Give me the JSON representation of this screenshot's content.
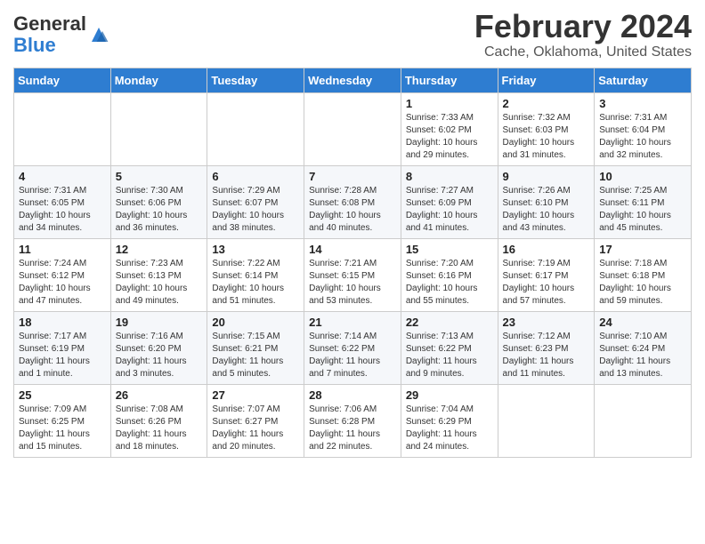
{
  "logo": {
    "general": "General",
    "blue": "Blue"
  },
  "title": "February 2024",
  "subtitle": "Cache, Oklahoma, United States",
  "days_header": [
    "Sunday",
    "Monday",
    "Tuesday",
    "Wednesday",
    "Thursday",
    "Friday",
    "Saturday"
  ],
  "weeks": [
    [
      {
        "day": "",
        "info": ""
      },
      {
        "day": "",
        "info": ""
      },
      {
        "day": "",
        "info": ""
      },
      {
        "day": "",
        "info": ""
      },
      {
        "day": "1",
        "info": "Sunrise: 7:33 AM\nSunset: 6:02 PM\nDaylight: 10 hours\nand 29 minutes."
      },
      {
        "day": "2",
        "info": "Sunrise: 7:32 AM\nSunset: 6:03 PM\nDaylight: 10 hours\nand 31 minutes."
      },
      {
        "day": "3",
        "info": "Sunrise: 7:31 AM\nSunset: 6:04 PM\nDaylight: 10 hours\nand 32 minutes."
      }
    ],
    [
      {
        "day": "4",
        "info": "Sunrise: 7:31 AM\nSunset: 6:05 PM\nDaylight: 10 hours\nand 34 minutes."
      },
      {
        "day": "5",
        "info": "Sunrise: 7:30 AM\nSunset: 6:06 PM\nDaylight: 10 hours\nand 36 minutes."
      },
      {
        "day": "6",
        "info": "Sunrise: 7:29 AM\nSunset: 6:07 PM\nDaylight: 10 hours\nand 38 minutes."
      },
      {
        "day": "7",
        "info": "Sunrise: 7:28 AM\nSunset: 6:08 PM\nDaylight: 10 hours\nand 40 minutes."
      },
      {
        "day": "8",
        "info": "Sunrise: 7:27 AM\nSunset: 6:09 PM\nDaylight: 10 hours\nand 41 minutes."
      },
      {
        "day": "9",
        "info": "Sunrise: 7:26 AM\nSunset: 6:10 PM\nDaylight: 10 hours\nand 43 minutes."
      },
      {
        "day": "10",
        "info": "Sunrise: 7:25 AM\nSunset: 6:11 PM\nDaylight: 10 hours\nand 45 minutes."
      }
    ],
    [
      {
        "day": "11",
        "info": "Sunrise: 7:24 AM\nSunset: 6:12 PM\nDaylight: 10 hours\nand 47 minutes."
      },
      {
        "day": "12",
        "info": "Sunrise: 7:23 AM\nSunset: 6:13 PM\nDaylight: 10 hours\nand 49 minutes."
      },
      {
        "day": "13",
        "info": "Sunrise: 7:22 AM\nSunset: 6:14 PM\nDaylight: 10 hours\nand 51 minutes."
      },
      {
        "day": "14",
        "info": "Sunrise: 7:21 AM\nSunset: 6:15 PM\nDaylight: 10 hours\nand 53 minutes."
      },
      {
        "day": "15",
        "info": "Sunrise: 7:20 AM\nSunset: 6:16 PM\nDaylight: 10 hours\nand 55 minutes."
      },
      {
        "day": "16",
        "info": "Sunrise: 7:19 AM\nSunset: 6:17 PM\nDaylight: 10 hours\nand 57 minutes."
      },
      {
        "day": "17",
        "info": "Sunrise: 7:18 AM\nSunset: 6:18 PM\nDaylight: 10 hours\nand 59 minutes."
      }
    ],
    [
      {
        "day": "18",
        "info": "Sunrise: 7:17 AM\nSunset: 6:19 PM\nDaylight: 11 hours\nand 1 minute."
      },
      {
        "day": "19",
        "info": "Sunrise: 7:16 AM\nSunset: 6:20 PM\nDaylight: 11 hours\nand 3 minutes."
      },
      {
        "day": "20",
        "info": "Sunrise: 7:15 AM\nSunset: 6:21 PM\nDaylight: 11 hours\nand 5 minutes."
      },
      {
        "day": "21",
        "info": "Sunrise: 7:14 AM\nSunset: 6:22 PM\nDaylight: 11 hours\nand 7 minutes."
      },
      {
        "day": "22",
        "info": "Sunrise: 7:13 AM\nSunset: 6:22 PM\nDaylight: 11 hours\nand 9 minutes."
      },
      {
        "day": "23",
        "info": "Sunrise: 7:12 AM\nSunset: 6:23 PM\nDaylight: 11 hours\nand 11 minutes."
      },
      {
        "day": "24",
        "info": "Sunrise: 7:10 AM\nSunset: 6:24 PM\nDaylight: 11 hours\nand 13 minutes."
      }
    ],
    [
      {
        "day": "25",
        "info": "Sunrise: 7:09 AM\nSunset: 6:25 PM\nDaylight: 11 hours\nand 15 minutes."
      },
      {
        "day": "26",
        "info": "Sunrise: 7:08 AM\nSunset: 6:26 PM\nDaylight: 11 hours\nand 18 minutes."
      },
      {
        "day": "27",
        "info": "Sunrise: 7:07 AM\nSunset: 6:27 PM\nDaylight: 11 hours\nand 20 minutes."
      },
      {
        "day": "28",
        "info": "Sunrise: 7:06 AM\nSunset: 6:28 PM\nDaylight: 11 hours\nand 22 minutes."
      },
      {
        "day": "29",
        "info": "Sunrise: 7:04 AM\nSunset: 6:29 PM\nDaylight: 11 hours\nand 24 minutes."
      },
      {
        "day": "",
        "info": ""
      },
      {
        "day": "",
        "info": ""
      }
    ]
  ]
}
